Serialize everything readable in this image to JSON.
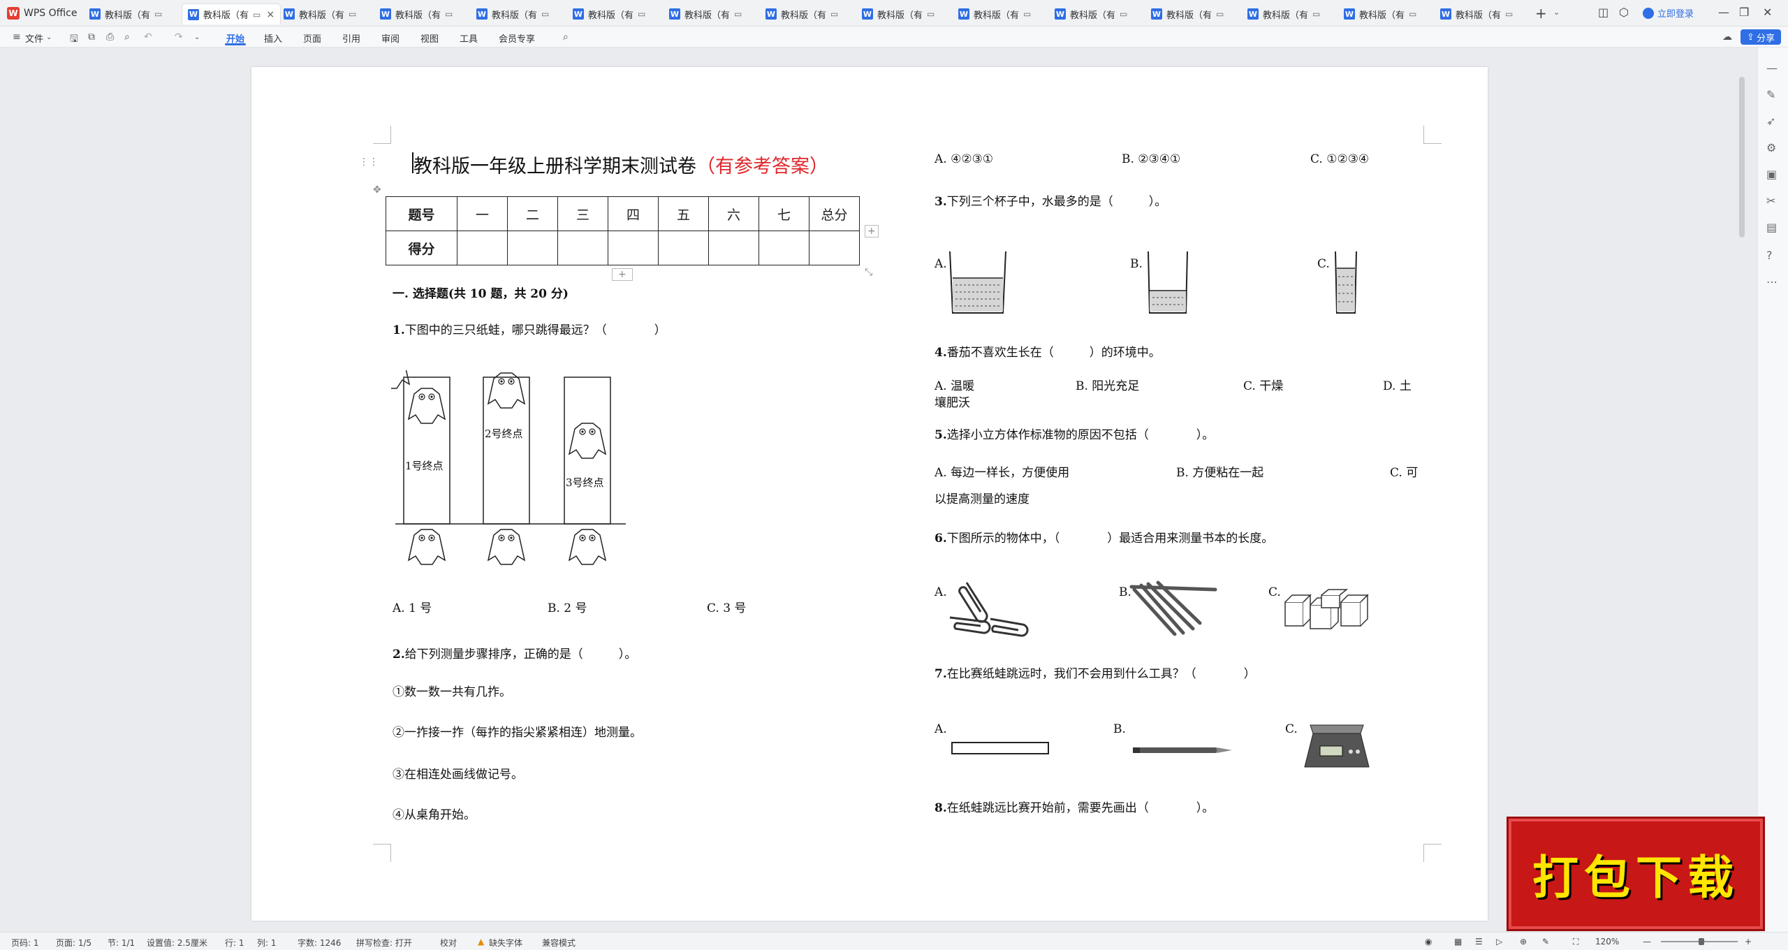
{
  "app": {
    "name": "WPS Office"
  },
  "tabs": [
    {
      "label": "教科版（有"
    },
    {
      "label": "教科版（有",
      "active": true
    },
    {
      "label": "教科版（有"
    },
    {
      "label": "教科版（有"
    },
    {
      "label": "教科版（有"
    },
    {
      "label": "教科版（有"
    },
    {
      "label": "教科版（有"
    },
    {
      "label": "教科版（有"
    },
    {
      "label": "教科版（有"
    },
    {
      "label": "教科版（有"
    },
    {
      "label": "教科版（有"
    },
    {
      "label": "教科版（有"
    },
    {
      "label": "教科版（有"
    },
    {
      "label": "教科版（有"
    },
    {
      "label": "教科版（有"
    }
  ],
  "account": {
    "login_label": "立即登录"
  },
  "menu": {
    "file": "文件",
    "items": [
      "开始",
      "插入",
      "页面",
      "引用",
      "审阅",
      "视图",
      "工具",
      "会员专享"
    ],
    "active": "开始",
    "share": "分享"
  },
  "document": {
    "title": "教科版一年级上册科学期末测试卷",
    "title_suffix": "（有参考答案）",
    "score_table": {
      "row1": [
        "题号",
        "一",
        "二",
        "三",
        "四",
        "五",
        "六",
        "七",
        "总分"
      ],
      "row2": [
        "得分",
        "",
        "",
        "",
        "",
        "",
        "",
        "",
        ""
      ]
    },
    "section1": "一. 选择题(共 10 题，共 20 分)",
    "q1": {
      "num": "1.",
      "text": "下图中的三只纸蛙，哪只跳得最远？（　　　　）",
      "labels": [
        "1号终点",
        "2号终点",
        "3号终点"
      ],
      "options": [
        "A. 1 号",
        "B. 2 号",
        "C. 3 号"
      ]
    },
    "q2": {
      "num": "2.",
      "text": "给下列测量步骤排序，正确的是（　　　）。",
      "steps": [
        "①数一数一共有几拃。",
        "②一拃接一拃（每拃的指尖紧紧相连）地测量。",
        "③在相连处画线做记号。",
        "④从桌角开始。"
      ],
      "options": [
        "A. ④②③①",
        "B. ②③④①",
        "C. ①②③④"
      ]
    },
    "q3": {
      "num": "3.",
      "text": "下列三个杯子中，水最多的是（　　　）。",
      "options": [
        "A.",
        "B.",
        "C."
      ]
    },
    "q4": {
      "num": "4.",
      "text": "番茄不喜欢生长在（　　　）的环境中。",
      "options": [
        "A. 温暖",
        "B. 阳光充足",
        "C. 干燥",
        "D. 土"
      ],
      "wrap": "壤肥沃"
    },
    "q5": {
      "num": "5.",
      "text": "选择小立方体作标准物的原因不包括（　　　　）。",
      "options": [
        "A. 每边一样长，方便使用",
        "B. 方便粘在一起",
        "C. 可"
      ],
      "wrap": "以提高测量的速度"
    },
    "q6": {
      "num": "6.",
      "text": "下图所示的物体中，（　　　　）最适合用来测量书本的长度。",
      "options": [
        "A.",
        "B.",
        "C."
      ]
    },
    "q7": {
      "num": "7.",
      "text": "在比赛纸蛙跳远时，我们不会用到什么工具？（　　　　）",
      "options": [
        "A.",
        "B.",
        "C."
      ]
    },
    "q8": {
      "num": "8.",
      "text": "在纸蛙跳远比赛开始前，需要先画出（　　　　）。"
    }
  },
  "status": {
    "page_num": "页码: 1",
    "pages": "页面: 1/5",
    "section": "节: 1/1",
    "setting": "设置值: 2.5厘米",
    "row": "行: 1",
    "col": "列: 1",
    "words": "字数: 1246",
    "spell": "拼写检查: 打开",
    "proof": "校对",
    "missing_font": "缺失字体",
    "compat": "兼容模式",
    "zoom": "120%"
  },
  "banner": {
    "text": "打包下载"
  },
  "colors": {
    "accent": "#2f6ee5",
    "title_red": "#e0262a",
    "banner_red": "#c71717",
    "banner_text": "#ffe600"
  }
}
